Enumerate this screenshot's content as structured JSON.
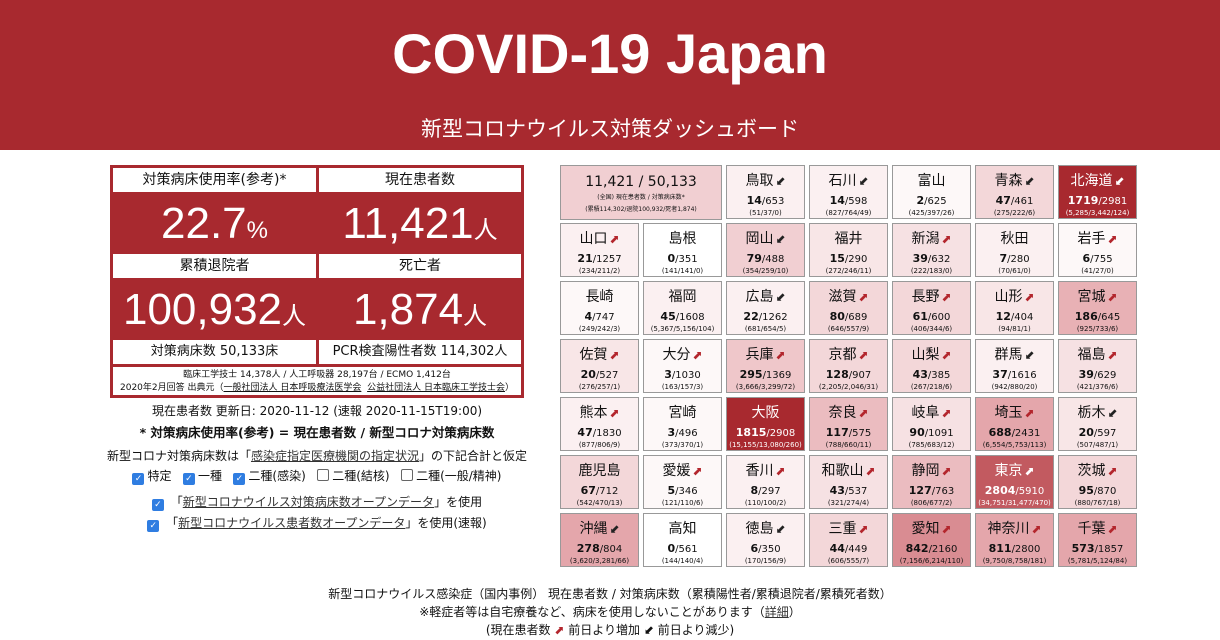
{
  "header": {
    "title": "COVID-19 Japan",
    "subtitle": "新型コロナウイルス対策ダッシュボード"
  },
  "stats": {
    "usage_label": "対策病床使用率(参考)*",
    "usage_value": "22.7",
    "usage_unit": "%",
    "patients_label": "現在患者数",
    "patients_value": "11,421",
    "patients_unit": "人",
    "discharged_label": "累積退院者",
    "discharged_value": "100,932",
    "discharged_unit": "人",
    "deaths_label": "死亡者",
    "deaths_value": "1,874",
    "deaths_unit": "人",
    "beds_text": "対策病床数 50,133床",
    "pcr_text": "PCR検査陽性者数 114,302人",
    "note_line1": "臨床工学技士 14,378人 / 人工呼吸器 28,197台 / ECMO 1,412台",
    "note_line2_prefix": "2020年2月回答 出典元（",
    "note_link1": "一般社団法人 日本呼吸療法医学会",
    "note_link2": "公益社団法人 日本臨床工学技士会",
    "note_line2_suffix": "）"
  },
  "info": {
    "updated": "現在患者数 更新日: 2020-11-12 (速報 2020-11-15T19:00)",
    "formula": "* 対策病床使用率(参考) = 現在患者数 / 新型コロナ対策病床数",
    "assume_prefix": "新型コロナ対策病床数は「",
    "assume_link": "感染症指定医療機関の指定状況",
    "assume_suffix": "」の下記合計と仮定",
    "opt1": "特定",
    "opt2": "一種",
    "opt3": "二種(感染)",
    "opt4": "二種(結核)",
    "opt5": "二種(一般/精神)",
    "use1_prefix": "「",
    "use1_link": "新型コロナウイルス対策病床数オープンデータ",
    "use1_suffix": "」を使用",
    "use2_prefix": "「",
    "use2_link": "新型コロナウイルス患者数オープンデータ",
    "use2_suffix": "」を使用(速報)",
    "check_on": "✓"
  },
  "summary": {
    "main": "11,421 / 50,133",
    "sub1": "(全国) 現在患者数 / 対策病床数*",
    "sub2": "(累積114,302/退院100,932/死者1,874)"
  },
  "colors": {
    "accent": "#a8292f",
    "up": "#b3262d",
    "check": "#2f7de1"
  },
  "prefectures": [
    {
      "name": "鳥取",
      "cur": "14",
      "beds": "653",
      "sub": "(51/37/0)",
      "trend": "down",
      "bg": "#fbf0f1"
    },
    {
      "name": "石川",
      "cur": "14",
      "beds": "598",
      "sub": "(827/764/49)",
      "trend": "down",
      "bg": "#fbf0f1"
    },
    {
      "name": "富山",
      "cur": "2",
      "beds": "625",
      "sub": "(425/397/26)",
      "trend": "none",
      "bg": "#fdf8f8"
    },
    {
      "name": "青森",
      "cur": "47",
      "beds": "461",
      "sub": "(275/222/6)",
      "trend": "down",
      "bg": "#f3d7d9"
    },
    {
      "name": "北海道",
      "cur": "1719",
      "beds": "2981",
      "sub": "(5,285/3,442/124)",
      "trend": "down",
      "bg": "#a8292f",
      "light": true
    },
    {
      "name": "山口",
      "cur": "21",
      "beds": "1257",
      "sub": "(234/211/2)",
      "trend": "up",
      "bg": "#fbf0f1"
    },
    {
      "name": "島根",
      "cur": "0",
      "beds": "351",
      "sub": "(141/141/0)",
      "trend": "none",
      "bg": "#ffffff"
    },
    {
      "name": "岡山",
      "cur": "79",
      "beds": "488",
      "sub": "(354/259/10)",
      "trend": "down",
      "bg": "#f1cfd2"
    },
    {
      "name": "福井",
      "cur": "15",
      "beds": "290",
      "sub": "(272/246/11)",
      "trend": "none",
      "bg": "#f8e6e7"
    },
    {
      "name": "新潟",
      "cur": "39",
      "beds": "632",
      "sub": "(222/183/0)",
      "trend": "up",
      "bg": "#f6e1e3"
    },
    {
      "name": "秋田",
      "cur": "7",
      "beds": "280",
      "sub": "(70/61/0)",
      "trend": "none",
      "bg": "#fbf0f1"
    },
    {
      "name": "岩手",
      "cur": "6",
      "beds": "755",
      "sub": "(41/27/0)",
      "trend": "up",
      "bg": "#fdf8f8"
    },
    {
      "name": "長崎",
      "cur": "4",
      "beds": "747",
      "sub": "(249/242/3)",
      "trend": "none",
      "bg": "#fdf8f8"
    },
    {
      "name": "福岡",
      "cur": "45",
      "beds": "1608",
      "sub": "(5,367/5,156/104)",
      "trend": "none",
      "bg": "#fbf0f1"
    },
    {
      "name": "広島",
      "cur": "22",
      "beds": "1262",
      "sub": "(681/654/5)",
      "trend": "down",
      "bg": "#fbf0f1"
    },
    {
      "name": "滋賀",
      "cur": "80",
      "beds": "689",
      "sub": "(646/557/9)",
      "trend": "up",
      "bg": "#f3d7d9"
    },
    {
      "name": "長野",
      "cur": "61",
      "beds": "600",
      "sub": "(406/344/6)",
      "trend": "up",
      "bg": "#f3d7d9"
    },
    {
      "name": "山形",
      "cur": "12",
      "beds": "404",
      "sub": "(94/81/1)",
      "trend": "up",
      "bg": "#f8e6e7"
    },
    {
      "name": "宮城",
      "cur": "186",
      "beds": "645",
      "sub": "(925/733/6)",
      "trend": "up",
      "bg": "#e8b1b5"
    },
    {
      "name": "佐賀",
      "cur": "20",
      "beds": "527",
      "sub": "(276/257/1)",
      "trend": "up",
      "bg": "#f8e6e7"
    },
    {
      "name": "大分",
      "cur": "3",
      "beds": "1030",
      "sub": "(163/157/3)",
      "trend": "up",
      "bg": "#fdf8f8"
    },
    {
      "name": "兵庫",
      "cur": "295",
      "beds": "1369",
      "sub": "(3,666/3,299/72)",
      "trend": "up",
      "bg": "#efc7ca"
    },
    {
      "name": "京都",
      "cur": "128",
      "beds": "907",
      "sub": "(2,205/2,046/31)",
      "trend": "up",
      "bg": "#f3d7d9"
    },
    {
      "name": "山梨",
      "cur": "43",
      "beds": "385",
      "sub": "(267/218/6)",
      "trend": "up",
      "bg": "#f3d7d9"
    },
    {
      "name": "群馬",
      "cur": "37",
      "beds": "1616",
      "sub": "(942/880/20)",
      "trend": "down",
      "bg": "#fbf0f1"
    },
    {
      "name": "福島",
      "cur": "39",
      "beds": "629",
      "sub": "(421/376/6)",
      "trend": "up",
      "bg": "#f6e1e3"
    },
    {
      "name": "熊本",
      "cur": "47",
      "beds": "1830",
      "sub": "(877/806/9)",
      "trend": "up",
      "bg": "#fbf0f1"
    },
    {
      "name": "宮崎",
      "cur": "3",
      "beds": "496",
      "sub": "(373/370/1)",
      "trend": "none",
      "bg": "#fdf8f8"
    },
    {
      "name": "大阪",
      "cur": "1815",
      "beds": "2908",
      "sub": "(15,155/13,080/260)",
      "trend": "none",
      "bg": "#a8292f",
      "light": true
    },
    {
      "name": "奈良",
      "cur": "117",
      "beds": "575",
      "sub": "(788/660/11)",
      "trend": "up",
      "bg": "#ebbcc0"
    },
    {
      "name": "岐阜",
      "cur": "90",
      "beds": "1091",
      "sub": "(785/683/12)",
      "trend": "up",
      "bg": "#f6e1e3"
    },
    {
      "name": "埼玉",
      "cur": "688",
      "beds": "2431",
      "sub": "(6,554/5,753/113)",
      "trend": "up",
      "bg": "#e4a6ab"
    },
    {
      "name": "栃木",
      "cur": "20",
      "beds": "597",
      "sub": "(507/487/1)",
      "trend": "down",
      "bg": "#f8e6e7"
    },
    {
      "name": "鹿児島",
      "cur": "67",
      "beds": "712",
      "sub": "(542/470/13)",
      "trend": "none",
      "bg": "#f3d7d9"
    },
    {
      "name": "愛媛",
      "cur": "5",
      "beds": "346",
      "sub": "(121/110/6)",
      "trend": "up",
      "bg": "#fdf8f8"
    },
    {
      "name": "香川",
      "cur": "8",
      "beds": "297",
      "sub": "(110/100/2)",
      "trend": "up",
      "bg": "#fbf0f1"
    },
    {
      "name": "和歌山",
      "cur": "43",
      "beds": "537",
      "sub": "(321/274/4)",
      "trend": "up",
      "bg": "#f6e1e3"
    },
    {
      "name": "静岡",
      "cur": "127",
      "beds": "763",
      "sub": "(806/677/2)",
      "trend": "up",
      "bg": "#ebbcc0"
    },
    {
      "name": "東京",
      "cur": "2804",
      "beds": "5910",
      "sub": "(34,751/31,477/470)",
      "trend": "up",
      "bg": "#c25a60",
      "light": true
    },
    {
      "name": "茨城",
      "cur": "95",
      "beds": "870",
      "sub": "(880/767/18)",
      "trend": "up",
      "bg": "#f3d7d9"
    },
    {
      "name": "沖縄",
      "cur": "278",
      "beds": "804",
      "sub": "(3,620/3,281/66)",
      "trend": "down",
      "bg": "#e4a6ab"
    },
    {
      "name": "高知",
      "cur": "0",
      "beds": "561",
      "sub": "(144/140/4)",
      "trend": "none",
      "bg": "#ffffff"
    },
    {
      "name": "徳島",
      "cur": "6",
      "beds": "350",
      "sub": "(170/156/9)",
      "trend": "down",
      "bg": "#fbf0f1"
    },
    {
      "name": "三重",
      "cur": "44",
      "beds": "449",
      "sub": "(606/555/7)",
      "trend": "up",
      "bg": "#f3d7d9"
    },
    {
      "name": "愛知",
      "cur": "842",
      "beds": "2160",
      "sub": "(7,156/6,214/110)",
      "trend": "up",
      "bg": "#d98c92"
    },
    {
      "name": "神奈川",
      "cur": "811",
      "beds": "2800",
      "sub": "(9,750/8,758/181)",
      "trend": "up",
      "bg": "#e4a6ab"
    },
    {
      "name": "千葉",
      "cur": "573",
      "beds": "1857",
      "sub": "(5,781/5,124/84)",
      "trend": "up",
      "bg": "#e4a6ab"
    }
  ],
  "bottom": {
    "line1": "新型コロナウイルス感染症（国内事例） 現在患者数 / 対策病床数（累積陽性者/累積退院者/累積死者数）",
    "line2_prefix": "※軽症者等は自宅療養など、病床を使用しないことがあります（",
    "line2_link": "詳細",
    "line2_suffix": "）",
    "line3_prefix": "(現在患者数",
    "line3_up": "前日より増加",
    "line3_down": "前日より減少",
    "line3_suffix": ")"
  }
}
